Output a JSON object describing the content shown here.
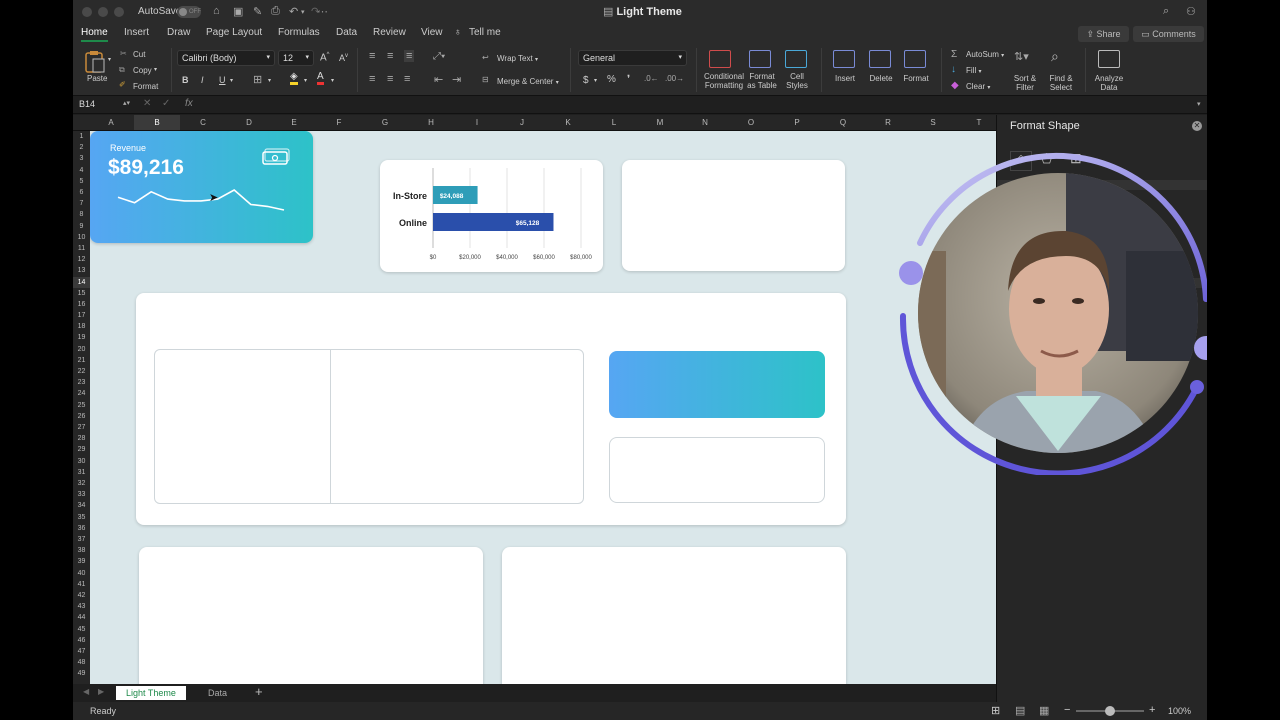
{
  "titlebar": {
    "autosave_label": "AutoSave",
    "autosave_state": "OFF",
    "window_title": "Light Theme"
  },
  "ribbon_tabs": [
    "Home",
    "Insert",
    "Draw",
    "Page Layout",
    "Formulas",
    "Data",
    "Review",
    "View"
  ],
  "tell_me": "Tell me",
  "share_label": "Share",
  "comments_label": "Comments",
  "ribbon": {
    "paste": "Paste",
    "cut": "Cut",
    "copy": "Copy",
    "format": "Format",
    "font_name": "Calibri (Body)",
    "font_size": "12",
    "bold": "B",
    "italic": "I",
    "underline": "U",
    "wrap_text": "Wrap Text",
    "merge_center": "Merge & Center",
    "number_format": "General",
    "conditional_formatting": [
      "Conditional",
      "Formatting"
    ],
    "format_as_table": [
      "Format",
      "as Table"
    ],
    "cell_styles": [
      "Cell",
      "Styles"
    ],
    "insert": "Insert",
    "delete": "Delete",
    "format_cells": "Format",
    "autosum": "AutoSum",
    "fill": "Fill",
    "clear": "Clear",
    "sort_filter": [
      "Sort &",
      "Filter"
    ],
    "find_select": [
      "Find &",
      "Select"
    ],
    "analyze_data": [
      "Analyze",
      "Data"
    ]
  },
  "formula_bar": {
    "name_box": "B14",
    "fx": "fx",
    "formula": ""
  },
  "columns": [
    "A",
    "B",
    "C",
    "D",
    "E",
    "F",
    "G",
    "H",
    "I",
    "J",
    "K",
    "L",
    "M",
    "N",
    "O",
    "P",
    "Q",
    "R",
    "S",
    "T"
  ],
  "selected_column": "B",
  "selected_row": "14",
  "rows": [
    "1",
    "2",
    "3",
    "4",
    "5",
    "6",
    "7",
    "8",
    "9",
    "10",
    "11",
    "12",
    "13",
    "14",
    "15",
    "16",
    "17",
    "18",
    "19",
    "20",
    "21",
    "22",
    "23",
    "24",
    "25",
    "26",
    "27",
    "28",
    "29",
    "30",
    "31",
    "32",
    "33",
    "34",
    "35",
    "36",
    "37",
    "38",
    "39",
    "40",
    "41",
    "42",
    "43",
    "44",
    "45",
    "46",
    "47",
    "48",
    "49"
  ],
  "revenue_card": {
    "label": "Revenue",
    "value": "$89,216",
    "sparkline": [
      3,
      6,
      0,
      4,
      5,
      5,
      4,
      -1,
      7,
      8,
      10
    ]
  },
  "chart_data": {
    "type": "bar",
    "orientation": "horizontal",
    "categories": [
      "In-Store",
      "Online"
    ],
    "values": [
      24088,
      65128
    ],
    "data_labels": [
      "$24,088",
      "$65,128"
    ],
    "colors": [
      "#2e9db8",
      "#2a4fab"
    ],
    "xticks": [
      "$0",
      "$20,000",
      "$40,000",
      "$60,000",
      "$80,000"
    ],
    "xlim": [
      0,
      80000
    ],
    "grid": true,
    "title": "",
    "xlabel": "",
    "ylabel": ""
  },
  "sheet_tabs": [
    "Light Theme",
    "Data"
  ],
  "active_sheet": "Light Theme",
  "status": {
    "text": "Ready",
    "zoom": "100%"
  },
  "format_pane": {
    "title": "Format Shape"
  }
}
